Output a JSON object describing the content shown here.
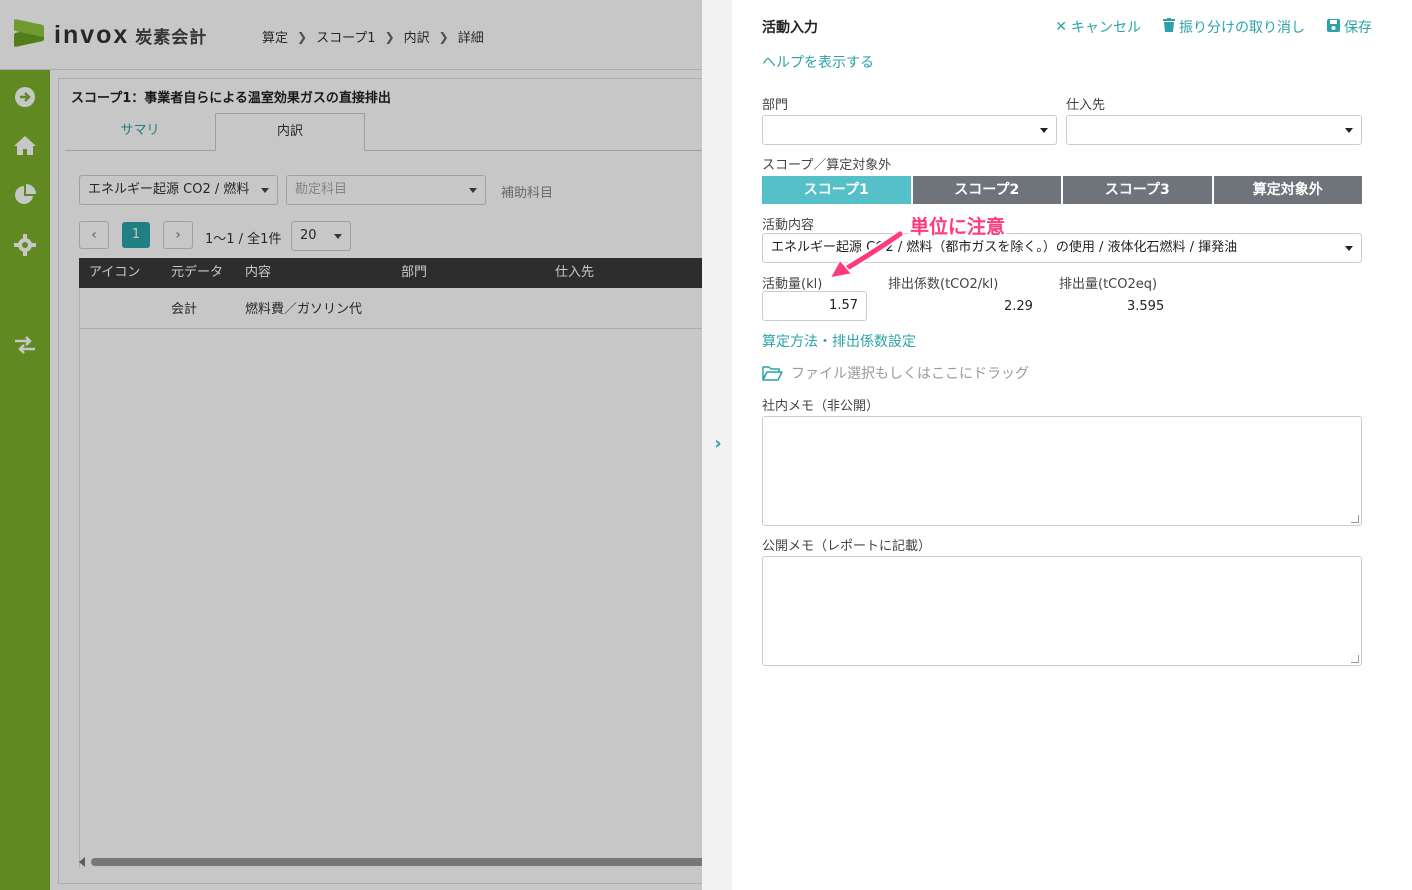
{
  "app": {
    "logo_text": "invox",
    "logo_sub": "炭素会計",
    "breadcrumb": [
      "算定",
      "スコープ1",
      "内訳",
      "詳細"
    ]
  },
  "sidebar": {
    "icons": [
      "arrow-right-circle-icon",
      "home-icon",
      "pie-chart-icon",
      "gear-icon",
      "transfer-icon"
    ]
  },
  "background_page": {
    "title": "スコープ1：事業者自らによる温室効果ガスの直接排出",
    "tabs": [
      "サマリ",
      "内訳"
    ],
    "filters": {
      "category": "エネルギー起源 CO2 / 燃料",
      "account_placeholder": "勘定科目",
      "sub_account_label": "補助科目"
    },
    "pager": {
      "current": "1",
      "info": "1〜1 / 全1件",
      "page_size": "20"
    },
    "table": {
      "columns": [
        "アイコン",
        "元データ",
        "内容",
        "部門",
        "仕入先"
      ],
      "rows": [
        {
          "icon": "",
          "source": "会計",
          "content": "燃料費／ガソリン代",
          "dept": "",
          "supplier": ""
        }
      ]
    }
  },
  "drawer": {
    "title": "活動入力",
    "actions": {
      "cancel": "キャンセル",
      "undo_split": "振り分けの取り消し",
      "save": "保存"
    },
    "help_link": "ヘルプを表示する",
    "department_label": "部門",
    "department_value": "",
    "supplier_label": "仕入先",
    "supplier_value": "",
    "scope_label": "スコープ／算定対象外",
    "scope_buttons": [
      "スコープ1",
      "スコープ2",
      "スコープ3",
      "算定対象外"
    ],
    "scope_selected": "スコープ1",
    "activity_label": "活動内容",
    "activity_value": "エネルギー起源 CO2 / 燃料（都市ガスを除く。）の使用 / 液体化石燃料 / 揮発油",
    "amount_label": "活動量(kl)",
    "amount_value": "1.57",
    "factor_label": "排出係数(tCO2/kl)",
    "factor_value": "2.29",
    "emission_label": "排出量(tCO2eq)",
    "emission_value": "3.595",
    "calc_link": "算定方法・排出係数設定",
    "file_drop": "ファイル選択もしくはここにドラッグ",
    "internal_memo_label": "社内メモ（非公開）",
    "public_memo_label": "公開メモ（レポートに記載）",
    "annotation": "単位に注意"
  },
  "colors": {
    "accent": "#2aa3a8",
    "sidebar": "#7cb02c",
    "scope_active": "#55c0c8",
    "scope_inactive": "#6e7479",
    "annotation": "#ff3b7b"
  }
}
